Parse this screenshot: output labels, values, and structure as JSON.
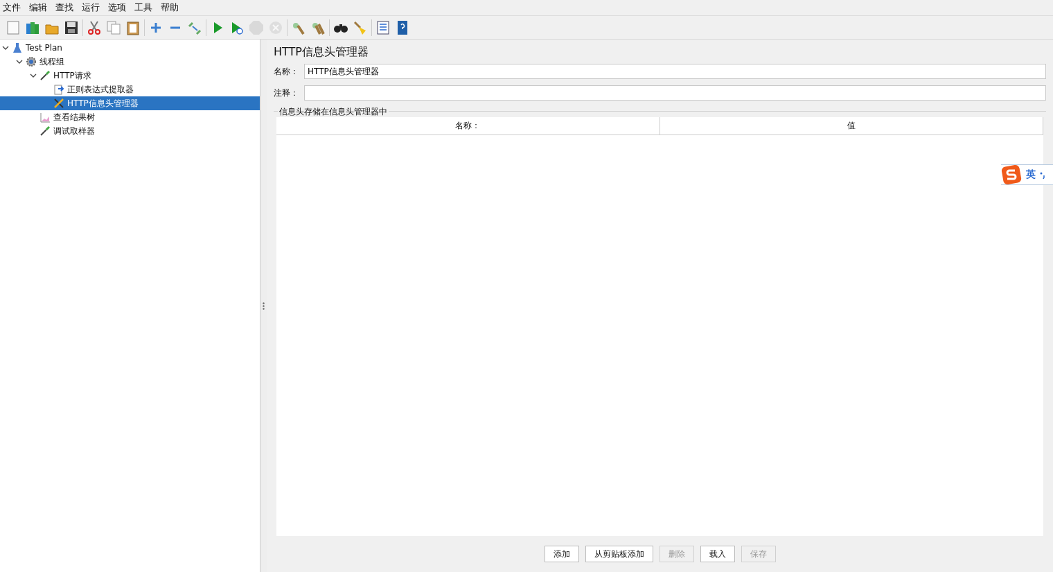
{
  "menu": [
    "文件",
    "编辑",
    "查找",
    "运行",
    "选项",
    "工具",
    "帮助"
  ],
  "toolbar": [
    {
      "kind": "new",
      "disabled": false
    },
    {
      "kind": "templates",
      "disabled": false
    },
    {
      "kind": "open",
      "disabled": false
    },
    {
      "kind": "save",
      "disabled": false
    },
    {
      "kind": "sep"
    },
    {
      "kind": "cut",
      "disabled": false
    },
    {
      "kind": "copy",
      "disabled": false
    },
    {
      "kind": "paste",
      "disabled": false
    },
    {
      "kind": "sep"
    },
    {
      "kind": "expand",
      "disabled": false
    },
    {
      "kind": "collapse",
      "disabled": false
    },
    {
      "kind": "toggle",
      "disabled": false
    },
    {
      "kind": "sep"
    },
    {
      "kind": "start",
      "disabled": false
    },
    {
      "kind": "start-no-pause",
      "disabled": false
    },
    {
      "kind": "stop",
      "disabled": true
    },
    {
      "kind": "shutdown",
      "disabled": true
    },
    {
      "kind": "sep"
    },
    {
      "kind": "clear",
      "disabled": false
    },
    {
      "kind": "clear-all",
      "disabled": false
    },
    {
      "kind": "sep"
    },
    {
      "kind": "search",
      "disabled": false
    },
    {
      "kind": "reset",
      "disabled": false
    },
    {
      "kind": "sep"
    },
    {
      "kind": "log",
      "disabled": false
    },
    {
      "kind": "help",
      "disabled": false
    }
  ],
  "tree": [
    {
      "label": "Test Plan",
      "kind": "plan",
      "expanded": true,
      "selected": false,
      "children": [
        {
          "label": "线程组",
          "kind": "gear",
          "expanded": true,
          "selected": false,
          "children": [
            {
              "label": "HTTP请求",
              "kind": "sampler",
              "expanded": true,
              "selected": false,
              "children": [
                {
                  "label": "正则表达式提取器",
                  "kind": "extractor",
                  "selected": false
                },
                {
                  "label": "HTTP信息头管理器",
                  "kind": "tools",
                  "selected": true
                }
              ]
            },
            {
              "label": "查看结果树",
              "kind": "chart",
              "selected": false
            },
            {
              "label": "调试取样器",
              "kind": "sampler",
              "selected": false
            }
          ]
        }
      ]
    }
  ],
  "panel": {
    "title": "HTTP信息头管理器",
    "name_label": "名称：",
    "name_value": "HTTP信息头管理器",
    "comment_label": "注释：",
    "group_title": "信息头存储在信息头管理器中",
    "columns": [
      "名称：",
      "值"
    ],
    "buttons": [
      {
        "label": "添加",
        "disabled": false
      },
      {
        "label": "从剪贴板添加",
        "disabled": false
      },
      {
        "label": "删除",
        "disabled": true
      },
      {
        "label": "载入",
        "disabled": false
      },
      {
        "label": "保存",
        "disabled": true
      }
    ]
  },
  "ime": {
    "label": "英"
  }
}
